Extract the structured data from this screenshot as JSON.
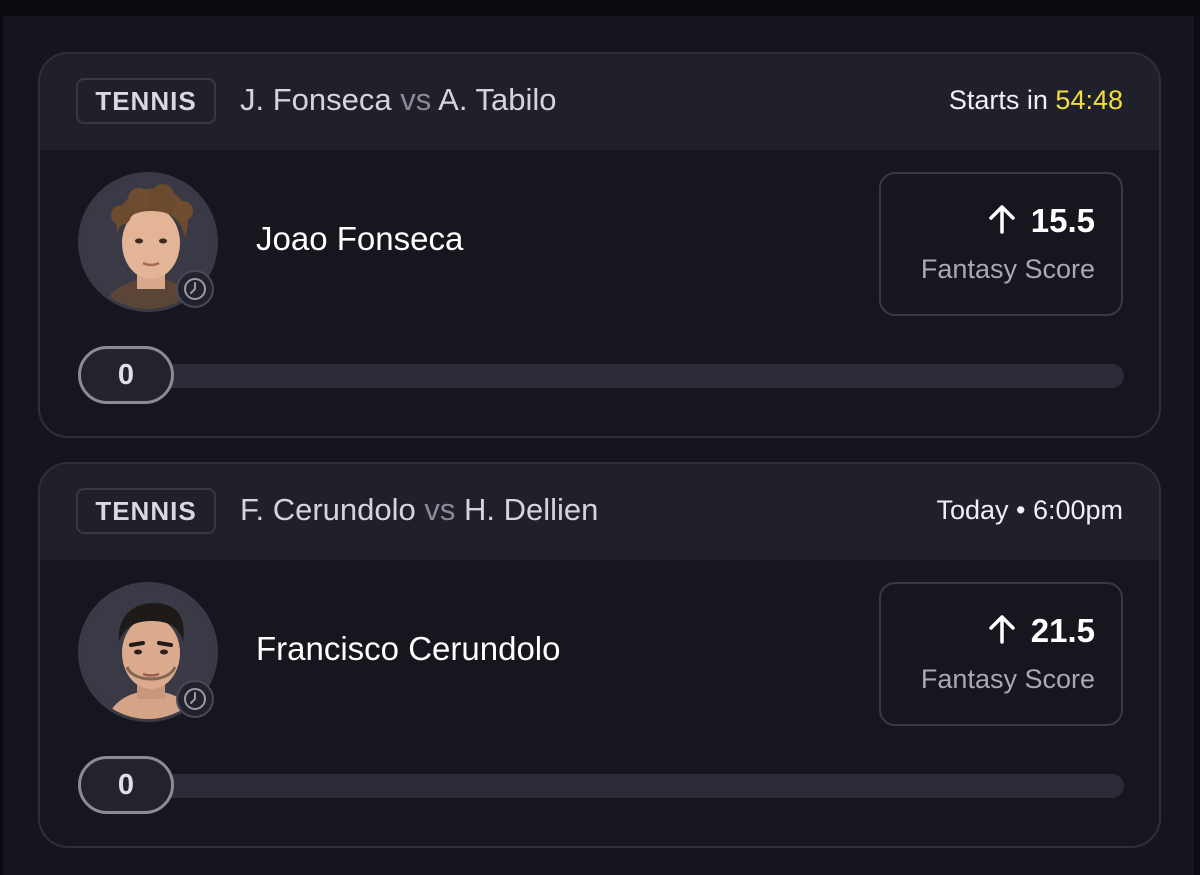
{
  "cards": [
    {
      "sport": "TENNIS",
      "player1": "J. Fonseca",
      "vs": "vs",
      "player2": "A. Tabilo",
      "start_prefix": "Starts in",
      "countdown": "54:48",
      "start_time": "",
      "player_name": "Joao Fonseca",
      "direction_icon": "arrow-up-icon",
      "score_value": "15.5",
      "score_label": "Fantasy Score",
      "progress_value": "0",
      "progress_fraction": 0
    },
    {
      "sport": "TENNIS",
      "player1": "F. Cerundolo",
      "vs": "vs",
      "player2": "H. Dellien",
      "start_prefix": "",
      "countdown": "",
      "start_time": "Today • 6:00pm",
      "player_name": "Francisco Cerundolo",
      "direction_icon": "arrow-up-icon",
      "score_value": "21.5",
      "score_label": "Fantasy Score",
      "progress_value": "0",
      "progress_fraction": 0
    }
  ],
  "colors": {
    "background": "#15151e",
    "card_header": "#20202b",
    "countdown_accent": "#f2dd3a",
    "muted_text": "#a8a8b6"
  }
}
